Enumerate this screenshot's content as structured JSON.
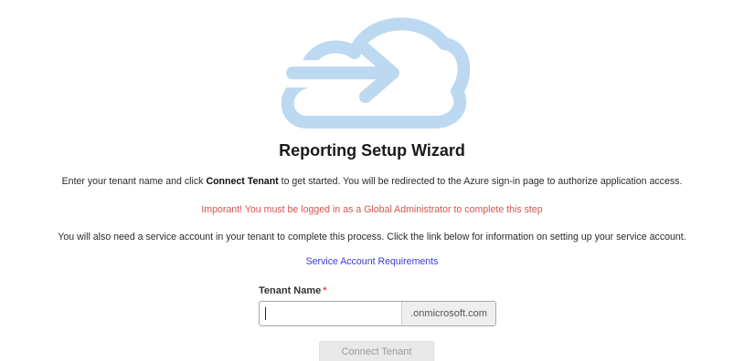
{
  "header": {
    "icon": "cloud-arrow-icon",
    "icon_color": "#b9d7f0"
  },
  "title": "Reporting Setup Wizard",
  "intro": {
    "before": "Enter your tenant name and click ",
    "bold": "Connect Tenant",
    "after": " to get started. You will be redirected to the Azure sign-in page to authorize application access."
  },
  "warning": "Imporant! You must be logged in as a Global Administrator to complete this step",
  "service_text": "You will also need a service account in your tenant to complete this process. Click the link below for information on setting up your service account.",
  "link_text": "Service Account Requirements",
  "form": {
    "label": "Tenant Name",
    "required_marker": "*",
    "value": "",
    "suffix": ".onmicrosoft.com",
    "button_label": "Connect Tenant"
  },
  "colors": {
    "warning": "#d9534f",
    "link": "#3b3bd6"
  }
}
